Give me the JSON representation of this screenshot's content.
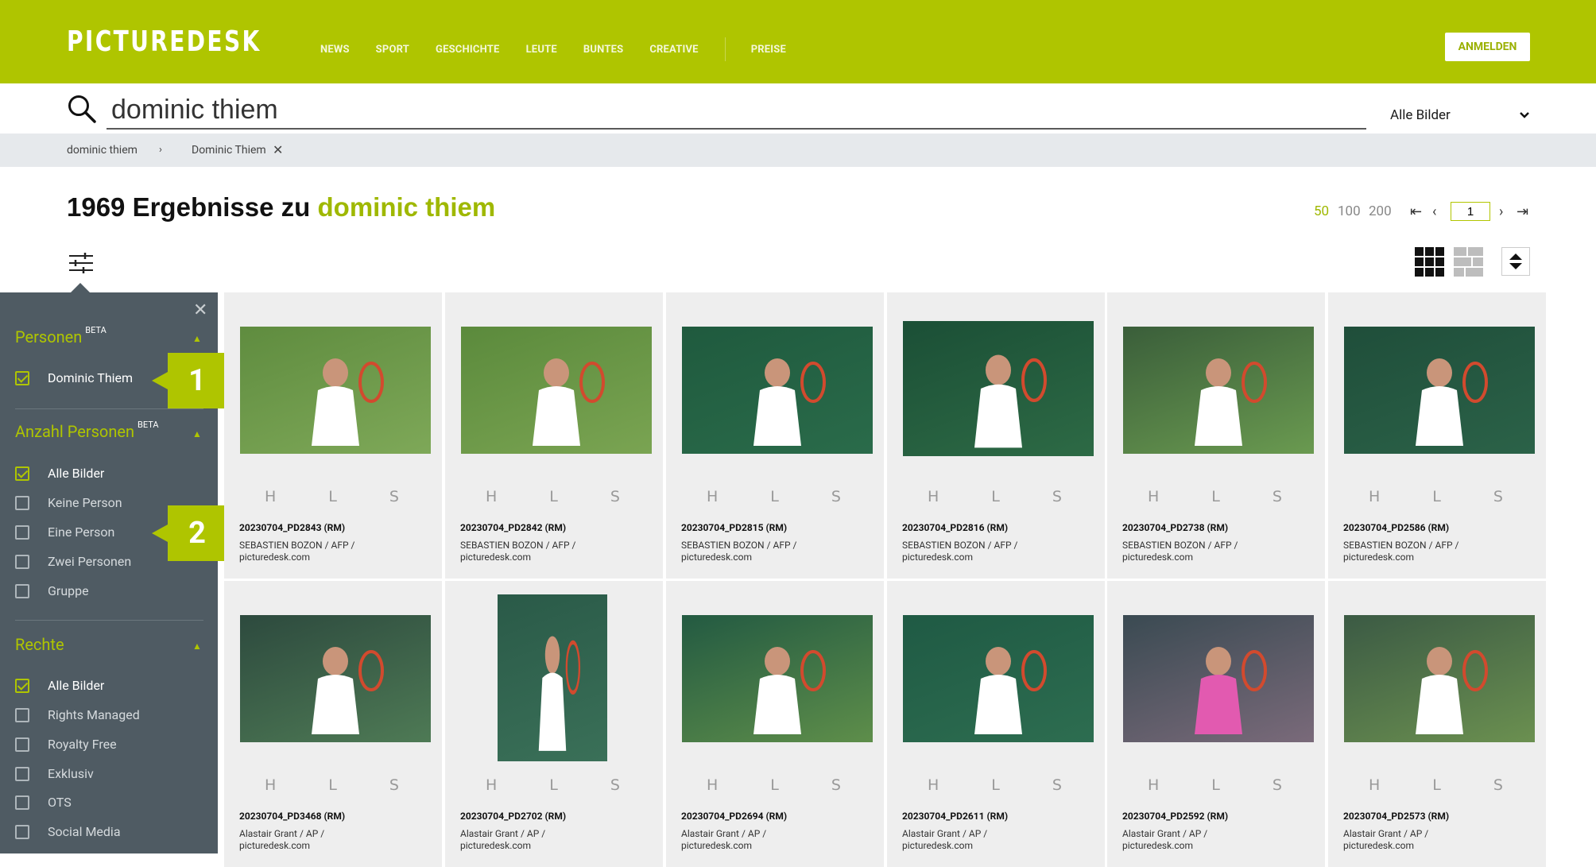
{
  "header": {
    "logo": "PICTUREDESK",
    "nav": [
      "NEWS",
      "SPORT",
      "GESCHICHTE",
      "LEUTE",
      "BUNTES",
      "CREATIVE"
    ],
    "nav_extra": "PREISE",
    "login": "ANMELDEN"
  },
  "search": {
    "query": "dominic thiem",
    "scope": "Alle Bilder"
  },
  "breadcrumb": {
    "first": "dominic thiem",
    "second": "Dominic Thiem"
  },
  "results": {
    "count_text": "1969 Ergebnisse zu",
    "keyword": "dominic thiem",
    "per_page": [
      "50",
      "100",
      "200"
    ],
    "page": "1"
  },
  "filters": {
    "personen": {
      "title": "Personen",
      "tag": "BETA",
      "options": [
        {
          "label": "Dominic Thiem",
          "checked": true
        }
      ]
    },
    "anzahl": {
      "title": "Anzahl Personen",
      "tag": "BETA",
      "options": [
        {
          "label": "Alle Bilder",
          "checked": true
        },
        {
          "label": "Keine Person",
          "checked": false
        },
        {
          "label": "Eine Person",
          "checked": false
        },
        {
          "label": "Zwei Personen",
          "checked": false
        },
        {
          "label": "Gruppe",
          "checked": false
        }
      ]
    },
    "rechte": {
      "title": "Rechte",
      "options": [
        {
          "label": "Alle Bilder",
          "checked": true
        },
        {
          "label": "Rights Managed",
          "checked": false
        },
        {
          "label": "Royalty Free",
          "checked": false
        },
        {
          "label": "Exklusiv",
          "checked": false
        },
        {
          "label": "OTS",
          "checked": false
        },
        {
          "label": "Social Media",
          "checked": false
        }
      ]
    },
    "callouts": [
      "1",
      "2"
    ]
  },
  "images": [
    {
      "id": "20230704_PD2843 (RM)",
      "credit": "SEBASTIEN BOZON / AFP / picturedesk.com",
      "sizes": "H L S"
    },
    {
      "id": "20230704_PD2842 (RM)",
      "credit": "SEBASTIEN BOZON / AFP / picturedesk.com",
      "sizes": "H L S"
    },
    {
      "id": "20230704_PD2815 (RM)",
      "credit": "SEBASTIEN BOZON / AFP / picturedesk.com",
      "sizes": "H L S"
    },
    {
      "id": "20230704_PD2816 (RM)",
      "credit": "SEBASTIEN BOZON / AFP / picturedesk.com",
      "sizes": "H L S"
    },
    {
      "id": "20230704_PD2738 (RM)",
      "credit": "SEBASTIEN BOZON / AFP / picturedesk.com",
      "sizes": "H L S"
    },
    {
      "id": "20230704_PD2586 (RM)",
      "credit": "SEBASTIEN BOZON / AFP / picturedesk.com",
      "sizes": "H L S"
    },
    {
      "id": "20230704_PD3468 (RM)",
      "credit": "Alastair Grant / AP / picturedesk.com",
      "sizes": "H L S"
    },
    {
      "id": "20230704_PD2702 (RM)",
      "credit": "Alastair Grant / AP / picturedesk.com",
      "sizes": "H L S"
    },
    {
      "id": "20230704_PD2694 (RM)",
      "credit": "Alastair Grant / AP / picturedesk.com",
      "sizes": "H L S"
    },
    {
      "id": "20230704_PD2611 (RM)",
      "credit": "Alastair Grant / AP / picturedesk.com",
      "sizes": "H L S"
    },
    {
      "id": "20230704_PD2592 (RM)",
      "credit": "Alastair Grant / AP / picturedesk.com",
      "sizes": "H L S"
    },
    {
      "id": "20230704_PD2573 (RM)",
      "credit": "Alastair Grant / AP / picturedesk.com",
      "sizes": "H L S"
    }
  ]
}
